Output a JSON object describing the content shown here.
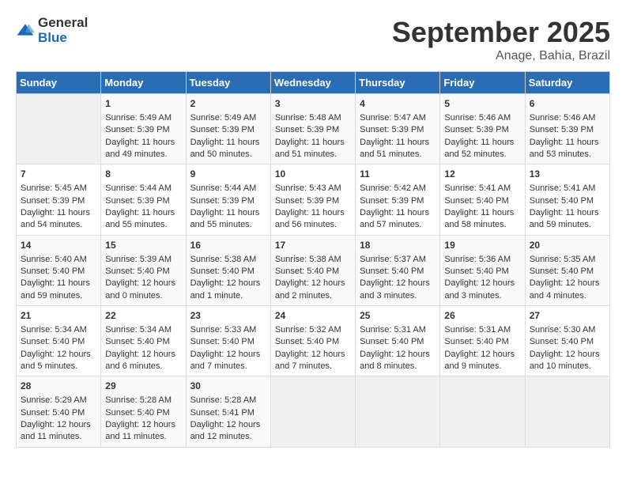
{
  "header": {
    "logo_line1": "General",
    "logo_line2": "Blue",
    "month": "September 2025",
    "location": "Anage, Bahia, Brazil"
  },
  "days_of_week": [
    "Sunday",
    "Monday",
    "Tuesday",
    "Wednesday",
    "Thursday",
    "Friday",
    "Saturday"
  ],
  "weeks": [
    [
      {
        "day": "",
        "info": ""
      },
      {
        "day": "1",
        "info": "Sunrise: 5:49 AM\nSunset: 5:39 PM\nDaylight: 11 hours\nand 49 minutes."
      },
      {
        "day": "2",
        "info": "Sunrise: 5:49 AM\nSunset: 5:39 PM\nDaylight: 11 hours\nand 50 minutes."
      },
      {
        "day": "3",
        "info": "Sunrise: 5:48 AM\nSunset: 5:39 PM\nDaylight: 11 hours\nand 51 minutes."
      },
      {
        "day": "4",
        "info": "Sunrise: 5:47 AM\nSunset: 5:39 PM\nDaylight: 11 hours\nand 51 minutes."
      },
      {
        "day": "5",
        "info": "Sunrise: 5:46 AM\nSunset: 5:39 PM\nDaylight: 11 hours\nand 52 minutes."
      },
      {
        "day": "6",
        "info": "Sunrise: 5:46 AM\nSunset: 5:39 PM\nDaylight: 11 hours\nand 53 minutes."
      }
    ],
    [
      {
        "day": "7",
        "info": "Sunrise: 5:45 AM\nSunset: 5:39 PM\nDaylight: 11 hours\nand 54 minutes."
      },
      {
        "day": "8",
        "info": "Sunrise: 5:44 AM\nSunset: 5:39 PM\nDaylight: 11 hours\nand 55 minutes."
      },
      {
        "day": "9",
        "info": "Sunrise: 5:44 AM\nSunset: 5:39 PM\nDaylight: 11 hours\nand 55 minutes."
      },
      {
        "day": "10",
        "info": "Sunrise: 5:43 AM\nSunset: 5:39 PM\nDaylight: 11 hours\nand 56 minutes."
      },
      {
        "day": "11",
        "info": "Sunrise: 5:42 AM\nSunset: 5:39 PM\nDaylight: 11 hours\nand 57 minutes."
      },
      {
        "day": "12",
        "info": "Sunrise: 5:41 AM\nSunset: 5:40 PM\nDaylight: 11 hours\nand 58 minutes."
      },
      {
        "day": "13",
        "info": "Sunrise: 5:41 AM\nSunset: 5:40 PM\nDaylight: 11 hours\nand 59 minutes."
      }
    ],
    [
      {
        "day": "14",
        "info": "Sunrise: 5:40 AM\nSunset: 5:40 PM\nDaylight: 11 hours\nand 59 minutes."
      },
      {
        "day": "15",
        "info": "Sunrise: 5:39 AM\nSunset: 5:40 PM\nDaylight: 12 hours\nand 0 minutes."
      },
      {
        "day": "16",
        "info": "Sunrise: 5:38 AM\nSunset: 5:40 PM\nDaylight: 12 hours\nand 1 minute."
      },
      {
        "day": "17",
        "info": "Sunrise: 5:38 AM\nSunset: 5:40 PM\nDaylight: 12 hours\nand 2 minutes."
      },
      {
        "day": "18",
        "info": "Sunrise: 5:37 AM\nSunset: 5:40 PM\nDaylight: 12 hours\nand 3 minutes."
      },
      {
        "day": "19",
        "info": "Sunrise: 5:36 AM\nSunset: 5:40 PM\nDaylight: 12 hours\nand 3 minutes."
      },
      {
        "day": "20",
        "info": "Sunrise: 5:35 AM\nSunset: 5:40 PM\nDaylight: 12 hours\nand 4 minutes."
      }
    ],
    [
      {
        "day": "21",
        "info": "Sunrise: 5:34 AM\nSunset: 5:40 PM\nDaylight: 12 hours\nand 5 minutes."
      },
      {
        "day": "22",
        "info": "Sunrise: 5:34 AM\nSunset: 5:40 PM\nDaylight: 12 hours\nand 6 minutes."
      },
      {
        "day": "23",
        "info": "Sunrise: 5:33 AM\nSunset: 5:40 PM\nDaylight: 12 hours\nand 7 minutes."
      },
      {
        "day": "24",
        "info": "Sunrise: 5:32 AM\nSunset: 5:40 PM\nDaylight: 12 hours\nand 7 minutes."
      },
      {
        "day": "25",
        "info": "Sunrise: 5:31 AM\nSunset: 5:40 PM\nDaylight: 12 hours\nand 8 minutes."
      },
      {
        "day": "26",
        "info": "Sunrise: 5:31 AM\nSunset: 5:40 PM\nDaylight: 12 hours\nand 9 minutes."
      },
      {
        "day": "27",
        "info": "Sunrise: 5:30 AM\nSunset: 5:40 PM\nDaylight: 12 hours\nand 10 minutes."
      }
    ],
    [
      {
        "day": "28",
        "info": "Sunrise: 5:29 AM\nSunset: 5:40 PM\nDaylight: 12 hours\nand 11 minutes."
      },
      {
        "day": "29",
        "info": "Sunrise: 5:28 AM\nSunset: 5:40 PM\nDaylight: 12 hours\nand 11 minutes."
      },
      {
        "day": "30",
        "info": "Sunrise: 5:28 AM\nSunset: 5:41 PM\nDaylight: 12 hours\nand 12 minutes."
      },
      {
        "day": "",
        "info": ""
      },
      {
        "day": "",
        "info": ""
      },
      {
        "day": "",
        "info": ""
      },
      {
        "day": "",
        "info": ""
      }
    ]
  ]
}
